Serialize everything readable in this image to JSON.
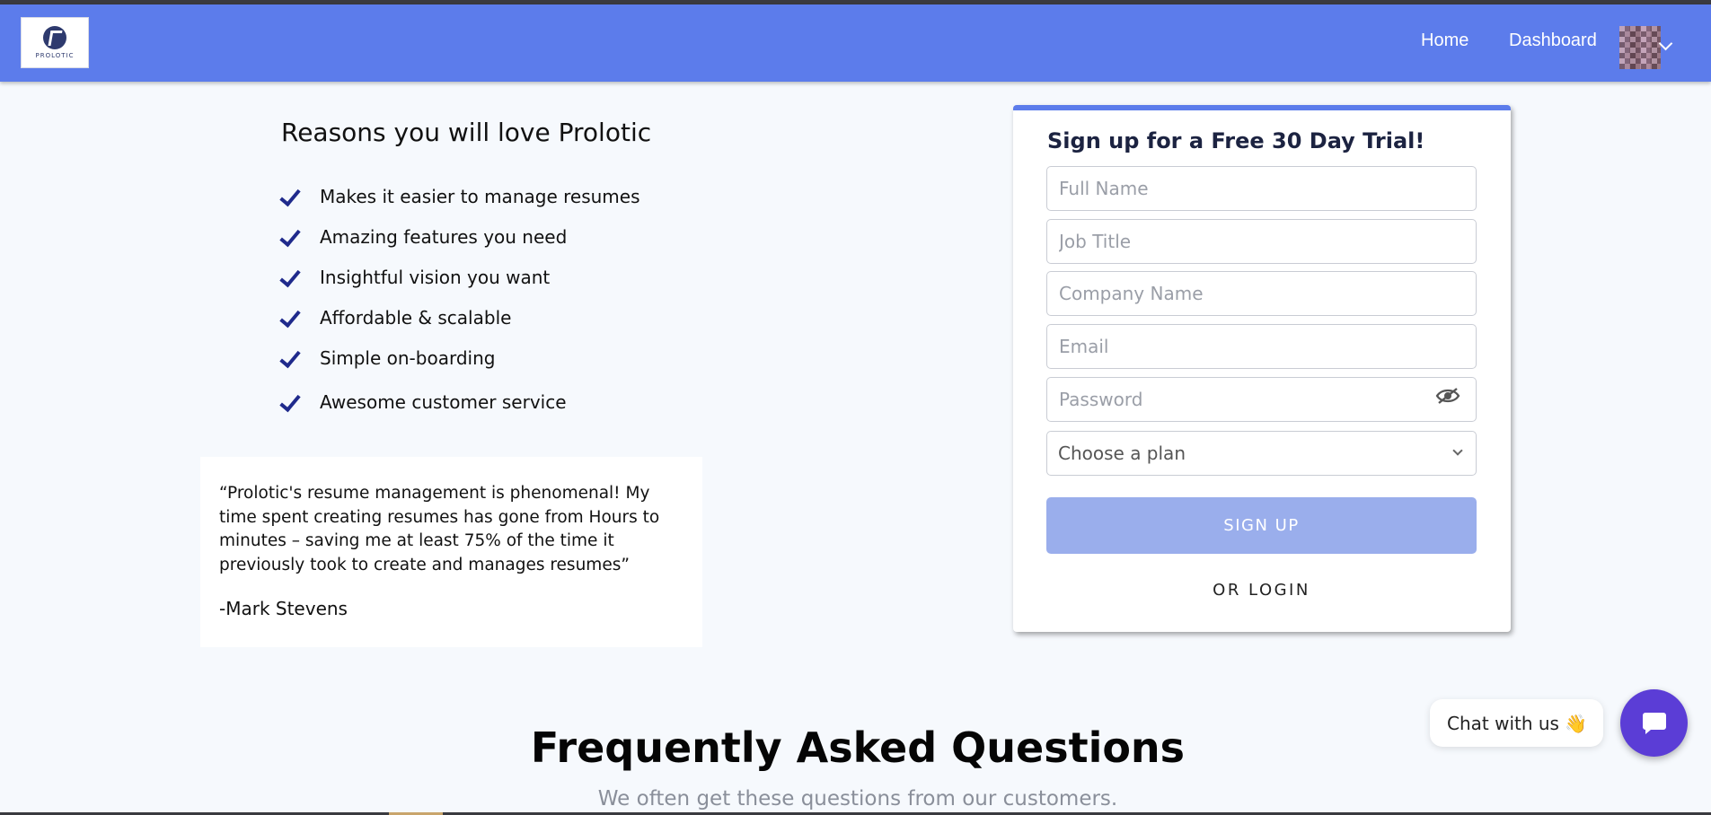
{
  "brand": {
    "logo_text": "PROLOTIC",
    "accent": "#5c7ceb"
  },
  "nav": {
    "home": "Home",
    "dashboard": "Dashboard"
  },
  "reasons": {
    "title": "Reasons you will love Prolotic",
    "items": [
      "Makes it easier to manage resumes",
      "Amazing features you need",
      "Insightful vision you want",
      "Affordable & scalable",
      "Simple on-boarding",
      "Awesome customer service"
    ]
  },
  "testimonial": {
    "quote": "“Prolotic's resume management is phenomenal! My time spent creating resumes has gone from Hours to minutes – saving me at least 75% of the time it previously took to create and manages resumes”",
    "author": "-Mark Stevens"
  },
  "signup": {
    "title": "Sign up for a Free 30 Day Trial!",
    "full_name_placeholder": "Full Name",
    "job_title_placeholder": "Job Title",
    "company_placeholder": "Company Name",
    "email_placeholder": "Email",
    "password_placeholder": "Password",
    "plan_selected": "Choose a plan",
    "submit_label": "SIGN UP",
    "login_label": "OR LOGIN"
  },
  "faq": {
    "title": "Frequently Asked Questions",
    "subtitle": "We often get these questions from our customers."
  },
  "chat": {
    "label": "Chat with us",
    "emoji": "👋"
  }
}
